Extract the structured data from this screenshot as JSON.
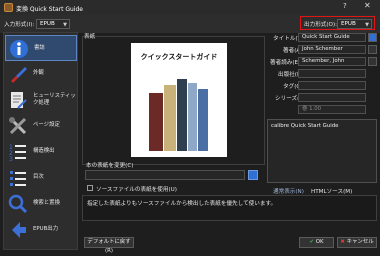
{
  "window": {
    "title": "変換 Quick Start Guide",
    "help": "?",
    "close": "✕"
  },
  "topbar": {
    "input_format_label": "入力形式(I):",
    "input_format_value": "EPUB",
    "output_format_label": "出力形式(O):",
    "output_format_value": "EPUB"
  },
  "sidebar": {
    "items": [
      {
        "label": "書誌",
        "icon": "info-icon"
      },
      {
        "label": "外観",
        "icon": "brush-icon"
      },
      {
        "label": "ヒューリスティック処理",
        "icon": "document-wand-icon"
      },
      {
        "label": "ページ設定",
        "icon": "tools-icon"
      },
      {
        "label": "構造検出",
        "icon": "numbered-list-icon"
      },
      {
        "label": "目次",
        "icon": "list-icon"
      },
      {
        "label": "検索と置換",
        "icon": "search-icon"
      },
      {
        "label": "EPUB出力",
        "icon": "arrow-icon"
      }
    ]
  },
  "cover": {
    "section_label": "表紙",
    "title": "クイックスタートガイド",
    "change_label": "本の表紙を変更(C)",
    "use_source_label": "ソースファイルの表紙を使用(U)"
  },
  "metadata": {
    "title_label": "タイトル(T)",
    "title_value": "Quick Start Guide",
    "author_label": "著者(A)",
    "author_value": "John Schember",
    "author_sort_label": "著者読み(E)",
    "author_sort_value": "Schember, John",
    "publisher_label": "出版社(P)",
    "publisher_value": "",
    "tags_label": "タグ(G)",
    "tags_value": "",
    "series_label": "シリーズ(S)",
    "series_value": "",
    "volume_value": "巻 1.00",
    "comments_value": "calibre Quick Start Guide",
    "tab_normal": "通常表示(N)",
    "tab_html": "HTMLソース(M)"
  },
  "description": "指定した表紙よりもソースファイルから検出した表紙を優先して使います。",
  "footer": {
    "defaults_label": "デフォルトに戻す(R)",
    "ok_label": "OK",
    "cancel_label": "キャンセル"
  },
  "colors": {
    "accent": "#2f4a6e",
    "highlight_border": "#e01515",
    "ok_check": "#4caf50",
    "cancel_x": "#e53935"
  }
}
